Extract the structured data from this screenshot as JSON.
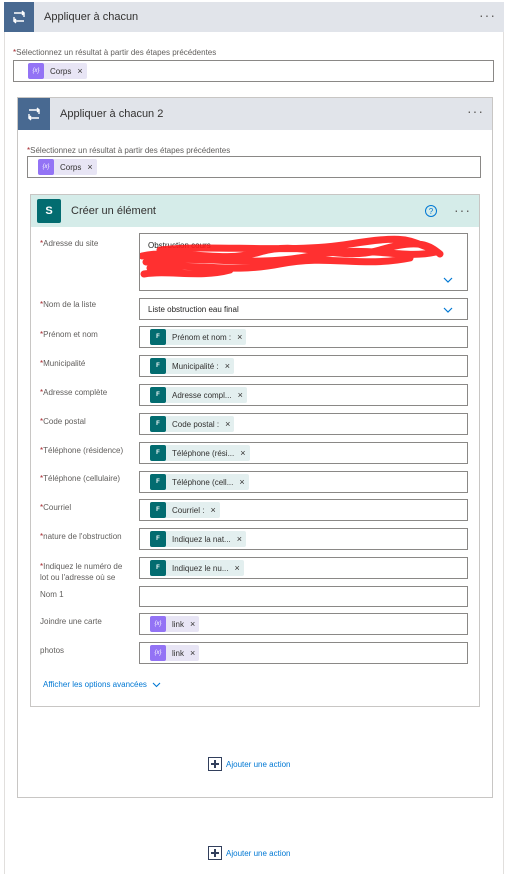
{
  "outer_loop": {
    "title": "Appliquer à chacun",
    "more": "···",
    "select_label": "Sélectionnez un résultat à partir des étapes précédentes",
    "token": {
      "label": "Corps",
      "close": "×",
      "icon": "expression-icon"
    }
  },
  "inner_loop": {
    "title": "Appliquer à chacun 2",
    "more": "···",
    "select_label": "Sélectionnez un résultat à partir des étapes précédentes",
    "token": {
      "label": "Corps",
      "close": "×",
      "icon": "expression-icon"
    }
  },
  "action": {
    "title": "Créer un élément",
    "help": "?",
    "more": "···",
    "fields": {
      "site": {
        "label": "Adresse du site",
        "value": "Obstruction cours"
      },
      "list": {
        "label": "Nom de la liste",
        "value": "Liste obstruction eau final"
      },
      "prenom": {
        "label": "Prénom et nom",
        "token": "Prénom et nom :"
      },
      "municipalite": {
        "label": "Municipalité",
        "token": "Municipalité :"
      },
      "adresse": {
        "label": "Adresse complète",
        "token": "Adresse compl..."
      },
      "code_postal": {
        "label": "Code postal",
        "token": "Code postal :"
      },
      "tel_res": {
        "label": "Téléphone (résidence)",
        "token": "Téléphone (rési..."
      },
      "tel_cell": {
        "label": "Téléphone (cellulaire)",
        "token": "Téléphone (cell..."
      },
      "courriel": {
        "label": "Courriel",
        "token": "Courriel :"
      },
      "nature": {
        "label": "nature de l'obstruction",
        "token": "Indiquez la nat..."
      },
      "lot": {
        "label_line1": "Indiquez le numéro de",
        "label_line2": "lot ou l'adresse où se",
        "token": "Indiquez le nu..."
      },
      "nom1": {
        "label": "Nom 1",
        "value": ""
      },
      "carte": {
        "label": "Joindre une carte",
        "token": "link"
      },
      "photos": {
        "label": "photos",
        "token": "link"
      }
    },
    "advanced": "Afficher les options avancées",
    "close": "×",
    "required_mark": "*"
  },
  "add_action_inner": "Ajouter une action",
  "add_action_outer": "Ajouter une action",
  "colors": {
    "loop_header": "#e1e4ea",
    "loop_icon": "#486991",
    "action_header": "#d5ece9",
    "sharepoint": "#036c70",
    "expression": "#9373f5",
    "link": "#0078d4",
    "required": "#a4262c",
    "redaction": "#ff1a1a"
  }
}
